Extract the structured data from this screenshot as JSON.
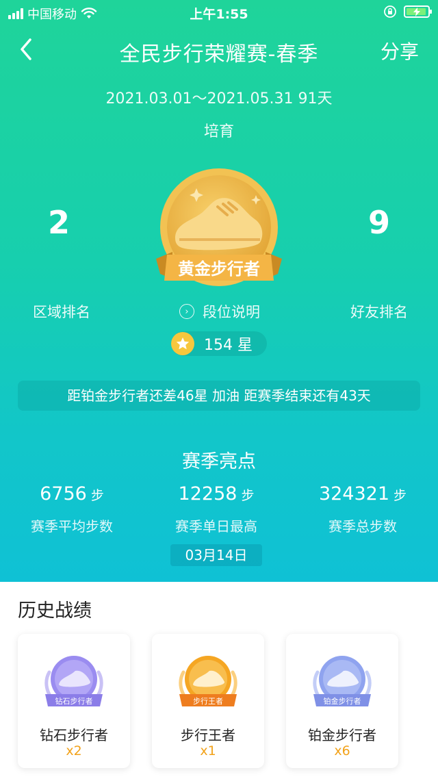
{
  "status_bar": {
    "carrier": "中国移动",
    "time": "上午1:55"
  },
  "nav": {
    "title": "全民步行荣耀赛-春季",
    "share_label": "分享"
  },
  "season": {
    "date_range": "2021.03.01～2021.05.31 91天",
    "stage": "培育",
    "region_rank": "2",
    "region_rank_label": "区域排名",
    "friend_rank": "9",
    "friend_rank_label": "好友排名",
    "badge_text": "黄金步行者",
    "explain_label": "段位说明",
    "stars": "154 星",
    "notice": "距铂金步行者还差46星 加油 距赛季结束还有43天"
  },
  "highlights": {
    "title": "赛季亮点",
    "stats": [
      {
        "value": "6756",
        "unit": "步",
        "label": "赛季平均步数"
      },
      {
        "value": "12258",
        "unit": "步",
        "label": "赛季单日最高"
      },
      {
        "value": "324321",
        "unit": "步",
        "label": "赛季总步数"
      }
    ],
    "best_day_date": "03月14日"
  },
  "history": {
    "title": "历史战绩",
    "cards": [
      {
        "medal_text": "钻石步行者",
        "name": "钻石步行者",
        "count": "x2",
        "color": "#9a8cf0"
      },
      {
        "medal_text": "步行王者",
        "name": "步行王者",
        "count": "x1",
        "color": "#f5a623"
      },
      {
        "medal_text": "铂金步行者",
        "name": "铂金步行者",
        "count": "x6",
        "color": "#8fa3ef"
      }
    ]
  },
  "colors": {
    "gradient_top": "#1fd49a",
    "gradient_bottom": "#0fc1d5",
    "gold": "#f0b93a",
    "count_orange": "#f2a21a"
  }
}
